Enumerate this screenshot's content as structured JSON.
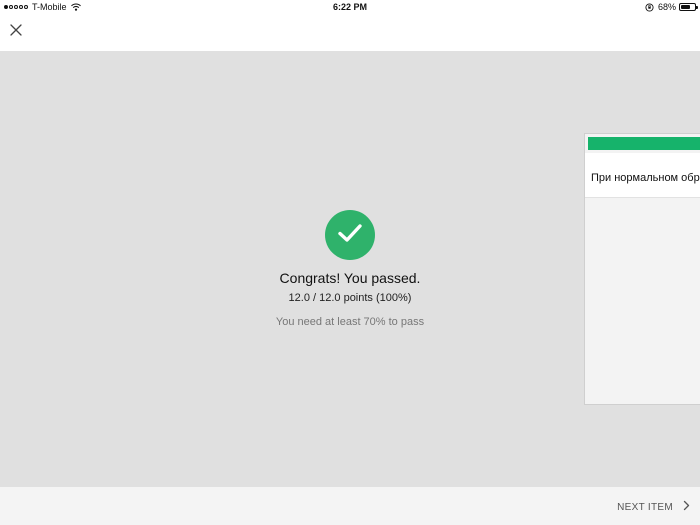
{
  "status_bar": {
    "carrier": "T-Mobile",
    "time": "6:22 PM",
    "battery_percent_label": "68%",
    "battery_level": 0.68,
    "signal_bars_filled": 1,
    "signal_bars_total": 5
  },
  "header": {
    "close_icon": "close-icon"
  },
  "result": {
    "title": "Congrats! You passed.",
    "score": "12.0 / 12.0 points (100%)",
    "requirement": "You need at least 70% to pass",
    "icon": "checkmark-icon",
    "color": "#2fb26b"
  },
  "next_card": {
    "text": "При нормальном обра",
    "accent_color": "#16b36b"
  },
  "footer": {
    "next_label": "NEXT ITEM",
    "next_icon": "chevron-right-icon"
  }
}
